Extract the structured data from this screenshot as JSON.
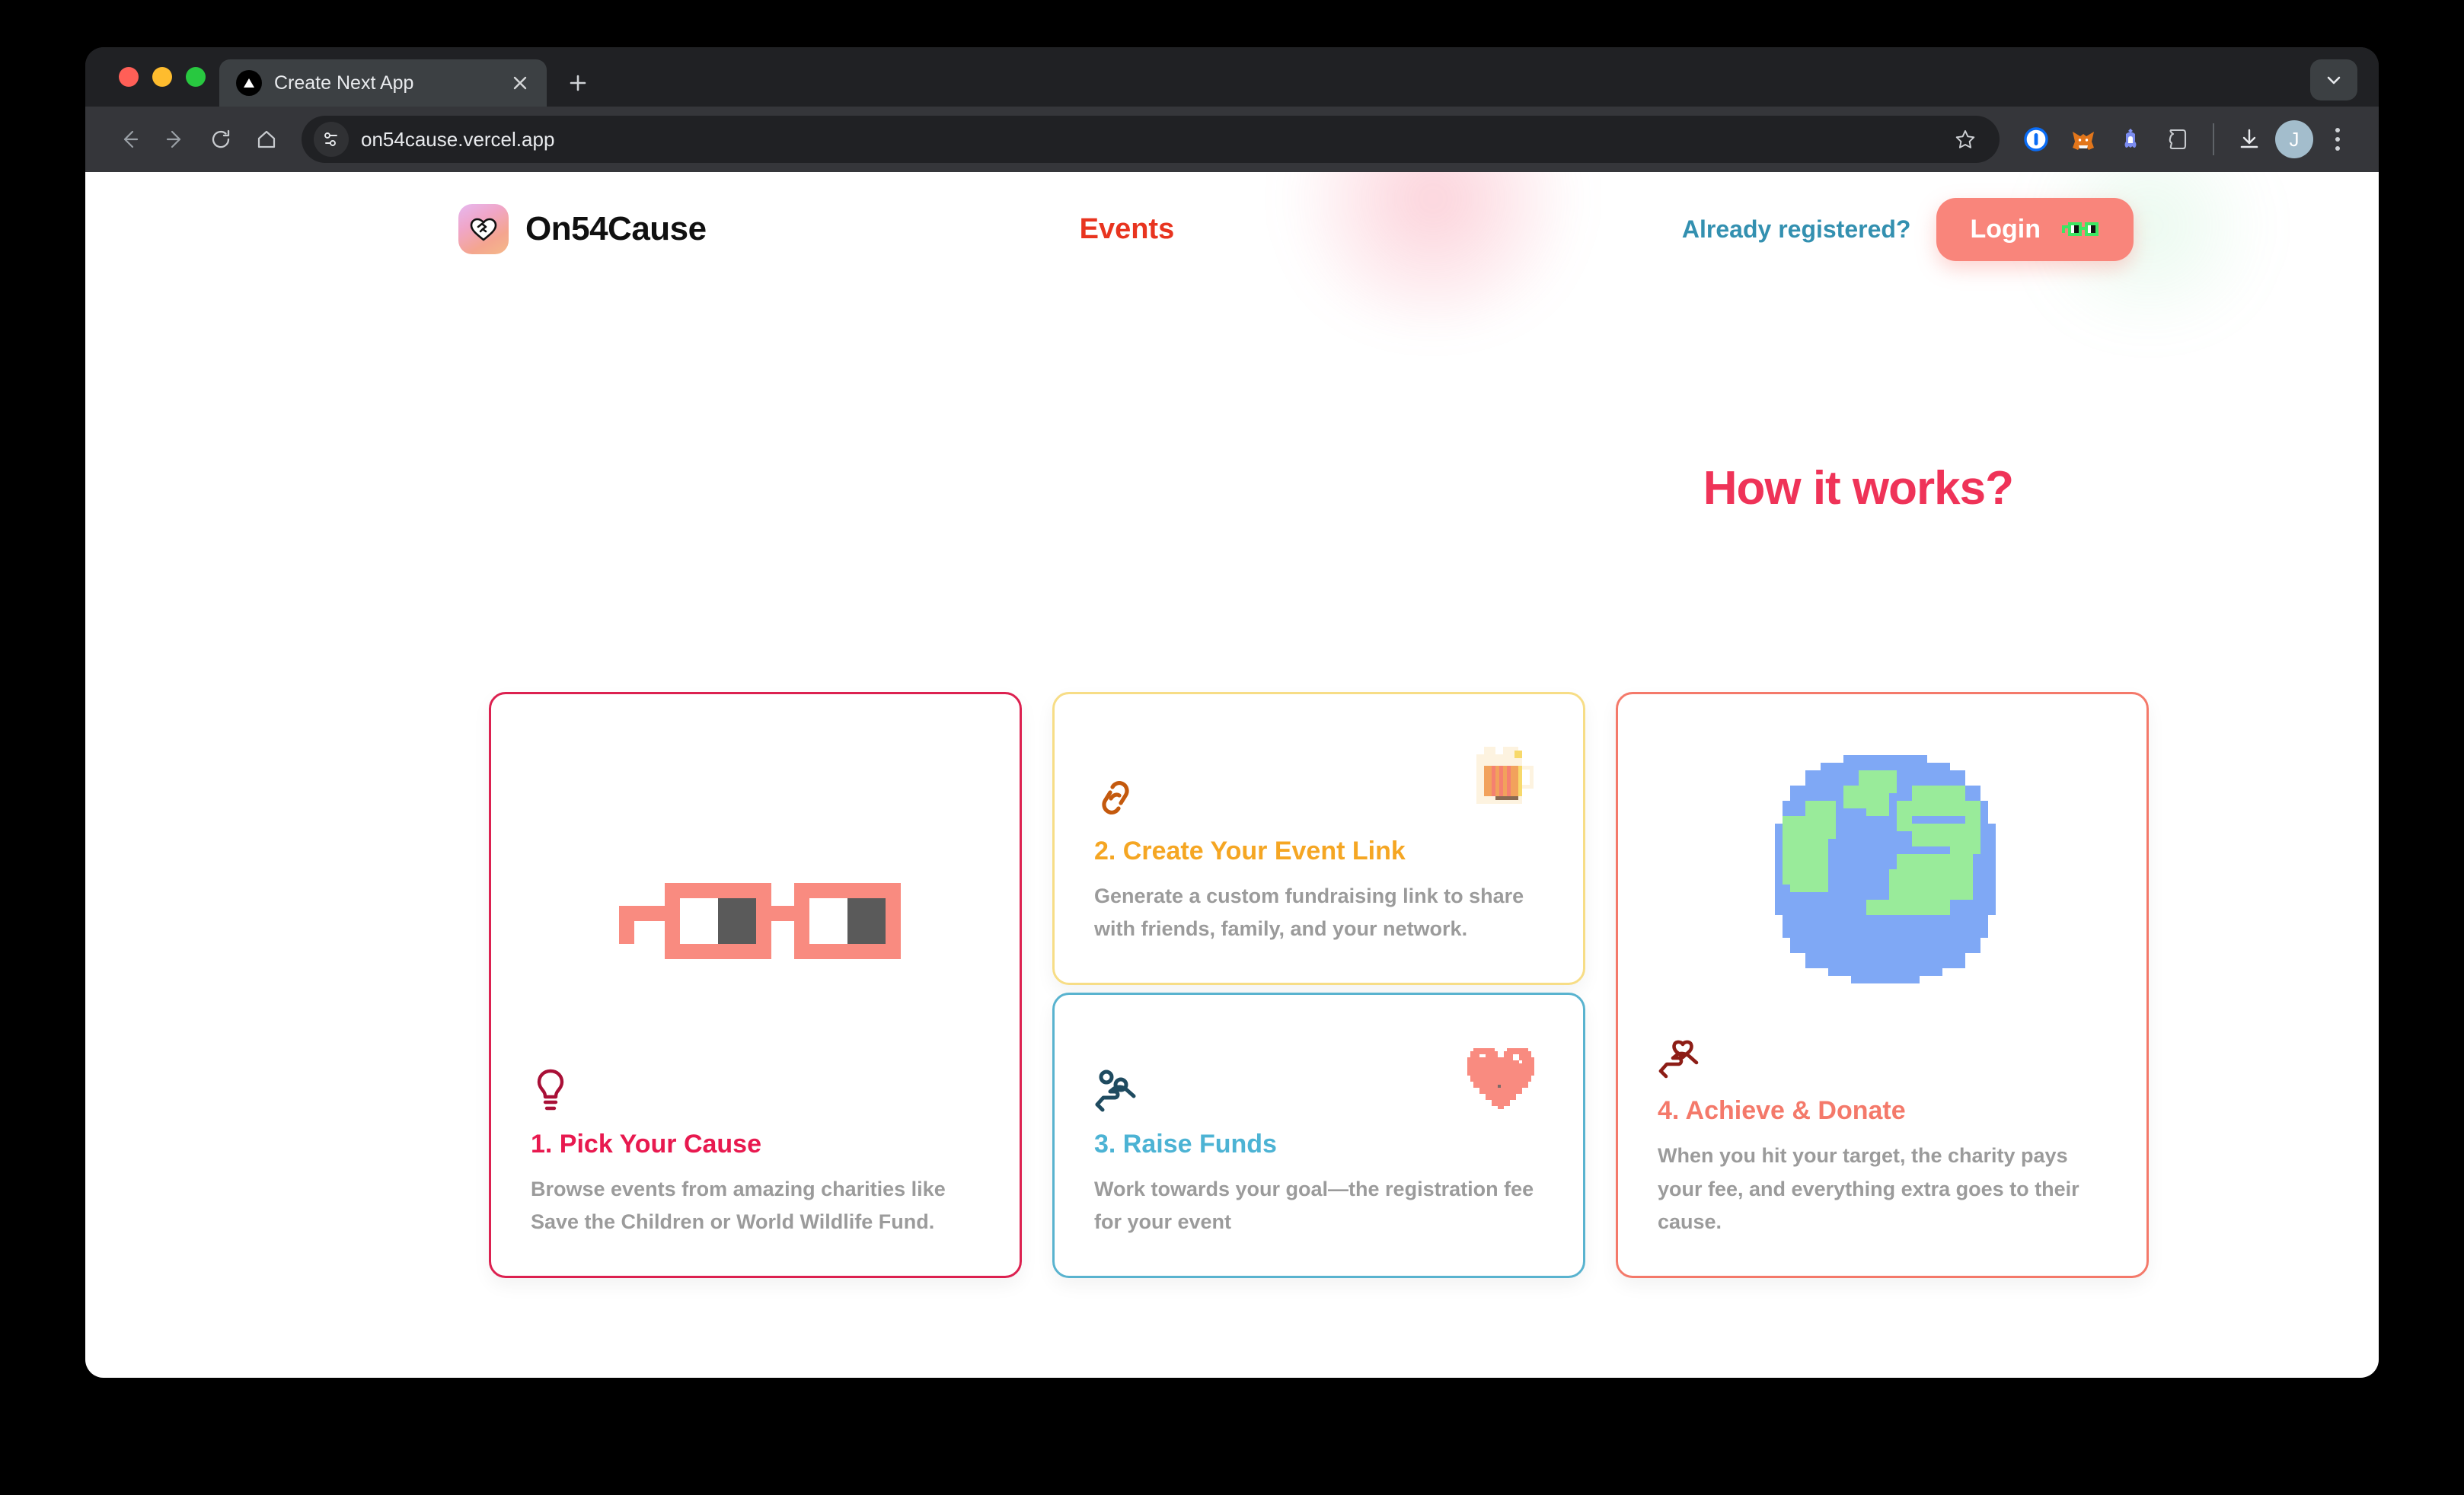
{
  "browser": {
    "tab": {
      "title": "Create Next App",
      "favicon_icon": "nextjs-triangle-icon",
      "close_icon": "close-icon"
    },
    "new_tab_icon": "plus-icon",
    "tab_list_icon": "chevron-down-icon",
    "toolbar": {
      "back_icon": "arrow-left-icon",
      "forward_icon": "arrow-right-icon",
      "reload_icon": "reload-icon",
      "home_icon": "home-icon",
      "site_settings_icon": "tune-icon",
      "url": "on54cause.vercel.app",
      "bookmark_icon": "star-icon",
      "extensions": [
        {
          "name": "onepassword-icon",
          "label": "1"
        },
        {
          "name": "metamask-fox-icon",
          "label": ""
        },
        {
          "name": "rabby-wallet-icon",
          "label": ""
        },
        {
          "name": "phantom-wallet-icon",
          "label": ""
        }
      ],
      "downloads_icon": "download-icon",
      "profile_initial": "J",
      "menu_icon": "three-dots-icon"
    }
  },
  "site": {
    "brand": {
      "logo_icon": "heart-handshake-icon",
      "name": "On54Cause"
    },
    "nav": {
      "events_label": "Events"
    },
    "auth": {
      "already_registered_label": "Already registered?",
      "login_label": "Login",
      "login_emoji": "pixel-glasses-emoji"
    },
    "section": {
      "title": "How it works?"
    },
    "cards": [
      {
        "id": "pick-your-cause",
        "number": "1.",
        "title": "1. Pick Your Cause",
        "description": "Browse events from amazing charities like Save the Children or World Wildlife Fund.",
        "icon": "lightbulb-icon",
        "emoji": "pixel-glasses-emoji",
        "border_color": "#dc2150",
        "title_color": "#e8194f"
      },
      {
        "id": "create-your-event-link",
        "number": "2.",
        "title": "2. Create Your Event Link",
        "description": "Generate a custom fundraising link to share with friends, family, and your network.",
        "icon": "link-icon",
        "emoji": "pixel-beer-mug-emoji",
        "border_color": "#f7dd86",
        "title_color": "#f5a623"
      },
      {
        "id": "raise-funds",
        "number": "3.",
        "title": "3. Raise Funds",
        "description": "Work towards your goal—the registration fee for your event",
        "icon": "hand-holding-person-icon",
        "emoji": "pixel-heart-emoji",
        "border_color": "#59b3cf",
        "title_color": "#4cb3d4"
      },
      {
        "id": "achieve-and-donate",
        "number": "4.",
        "title": "4. Achieve & Donate",
        "description": "When you hit your target, the charity pays your fee, and everything extra goes to their cause.",
        "icon": "hand-holding-heart-icon",
        "emoji": "pixel-earth-globe-emoji",
        "border_color": "#f4796a",
        "title_color": "#f4796a"
      }
    ]
  },
  "colors": {
    "accent_pink": "#ef3358",
    "accent_coral": "#f9857b",
    "accent_teal": "#3390b0",
    "accent_red": "#e8341f",
    "accent_yellow": "#f5a623",
    "accent_blue": "#4cb3d4",
    "text_muted": "#9b9b9b"
  }
}
